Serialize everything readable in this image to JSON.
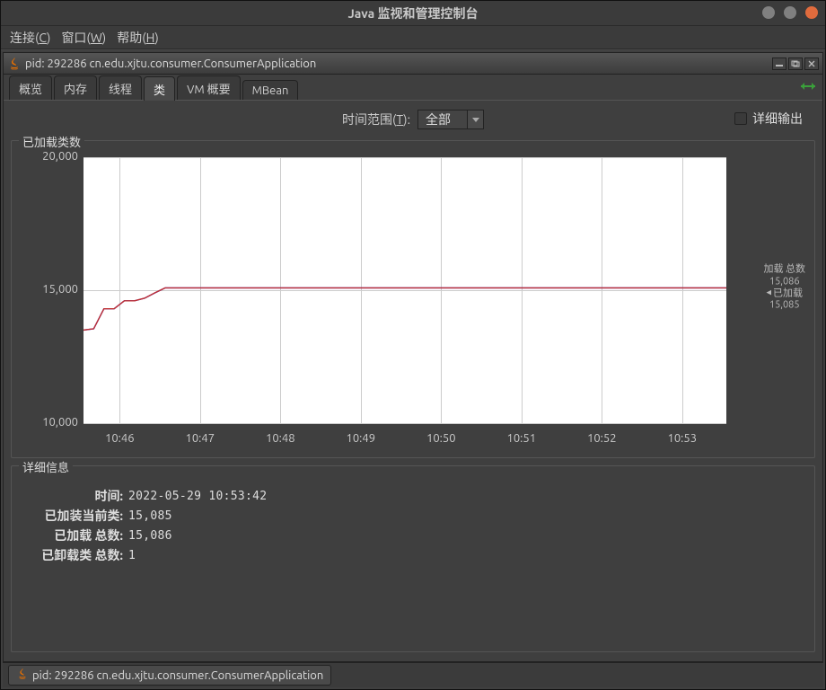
{
  "window": {
    "title": "Java 监视和管理控制台"
  },
  "menus": {
    "connect": "连接(",
    "connect_m": "C",
    "window": "窗口(",
    "window_m": "W",
    "help": "帮助(",
    "help_m": "H",
    "close": ")"
  },
  "internal_frame": {
    "title_prefix": "pid: 292286 cn.edu.xjtu.consumer.ConsumerApplication"
  },
  "tabs": [
    {
      "id": "overview",
      "label": "概览"
    },
    {
      "id": "memory",
      "label": "内存"
    },
    {
      "id": "threads",
      "label": "线程"
    },
    {
      "id": "classes",
      "label": "类"
    },
    {
      "id": "vm",
      "label": "VM 概要"
    },
    {
      "id": "mbean",
      "label": "MBean"
    }
  ],
  "active_tab_id": "classes",
  "toprow": {
    "range_label": "时间范围(",
    "range_m": "T",
    "range_close": "):",
    "range_value": "全部",
    "verbose_label": "详细输出"
  },
  "chart_group": {
    "legend_title": "已加载类数"
  },
  "side_legend": {
    "l1": "加载 总数",
    "v1": "15,086",
    "l2": "已加载",
    "v2": "15,085"
  },
  "chart_data": {
    "type": "line",
    "ylabel": "",
    "xlabel": "",
    "ylim": [
      10000,
      20000
    ],
    "yticks": [
      10000,
      15000,
      20000
    ],
    "ytick_labels": [
      "10,000",
      "15,000",
      "20,000"
    ],
    "x": [
      "10:46",
      "10:47",
      "10:48",
      "10:49",
      "10:50",
      "10:51",
      "10:52",
      "10:53"
    ],
    "series": [
      {
        "name": "已加载",
        "color": "#2b2bee",
        "values": [
          13500,
          13550,
          14300,
          14300,
          14600,
          14600,
          14700,
          14900,
          15085,
          15085,
          15085,
          15085,
          15085,
          15085,
          15085,
          15085,
          15085,
          15085,
          15085,
          15085,
          15085,
          15085,
          15085,
          15085,
          15085,
          15085,
          15085,
          15085,
          15085,
          15085,
          15085,
          15085,
          15085,
          15085,
          15085,
          15085,
          15085,
          15085,
          15085,
          15085,
          15085,
          15085,
          15085,
          15085,
          15085,
          15085,
          15085,
          15085,
          15085,
          15085,
          15085,
          15085,
          15085,
          15085,
          15085,
          15085,
          15085,
          15085,
          15085,
          15085,
          15085,
          15085,
          15085,
          15085
        ]
      },
      {
        "name": "加载 总数",
        "color": "#c03030",
        "values": [
          13501,
          13551,
          14301,
          14301,
          14601,
          14601,
          14701,
          14901,
          15086,
          15086,
          15086,
          15086,
          15086,
          15086,
          15086,
          15086,
          15086,
          15086,
          15086,
          15086,
          15086,
          15086,
          15086,
          15086,
          15086,
          15086,
          15086,
          15086,
          15086,
          15086,
          15086,
          15086,
          15086,
          15086,
          15086,
          15086,
          15086,
          15086,
          15086,
          15086,
          15086,
          15086,
          15086,
          15086,
          15086,
          15086,
          15086,
          15086,
          15086,
          15086,
          15086,
          15086,
          15086,
          15086,
          15086,
          15086,
          15086,
          15086,
          15086,
          15086,
          15086,
          15086,
          15086,
          15086
        ]
      }
    ]
  },
  "details_group": {
    "legend": "详细信息",
    "rows": [
      {
        "k": "时间:",
        "v": "2022-05-29 10:53:42"
      },
      {
        "k": "已加装当前类:",
        "v": "15,085"
      },
      {
        "k": "已加载 总数:",
        "v": "15,086"
      },
      {
        "k": "已卸载类 总数:",
        "v": "    1"
      }
    ]
  },
  "taskbar": {
    "label": "pid: 292286 cn.edu.xjtu.consumer.ConsumerApplication"
  }
}
